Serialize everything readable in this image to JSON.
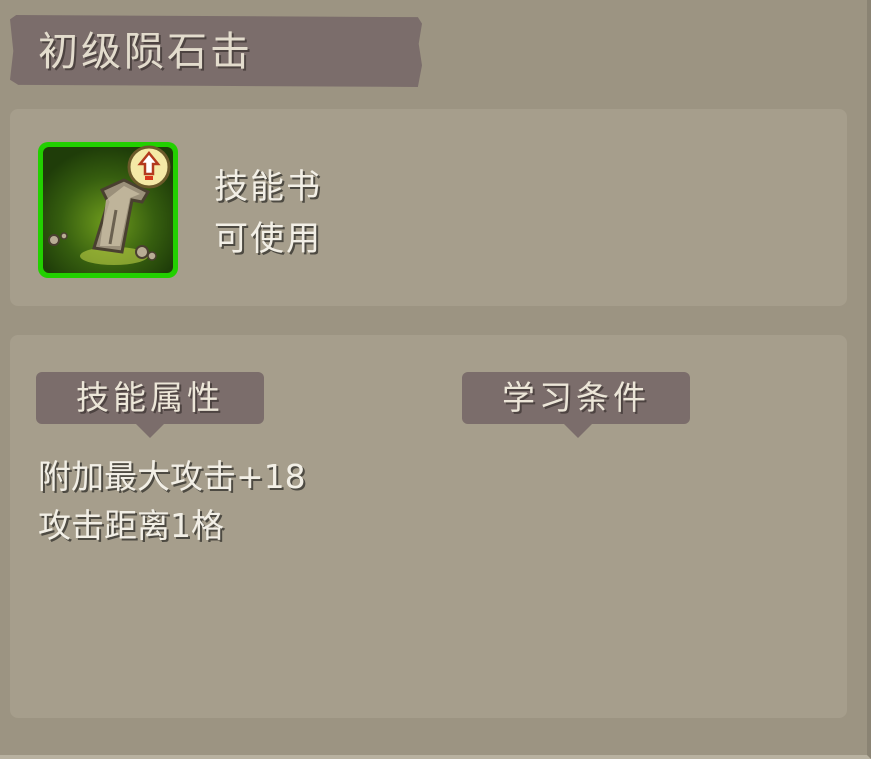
{
  "tooltip": {
    "title": "初级陨石击",
    "item": {
      "icon": "meteor-rock-skillbook-icon",
      "badge_icon": "upgrade-arrow-badge-icon",
      "frame_color": "#22d000",
      "type_line1": "技能书",
      "type_line2": "可使用"
    },
    "sections": {
      "attributes_label": "技能属性",
      "requirements_label": "学习条件"
    },
    "attributes": [
      "附加最大攻击+18",
      "攻击距离1格"
    ]
  }
}
